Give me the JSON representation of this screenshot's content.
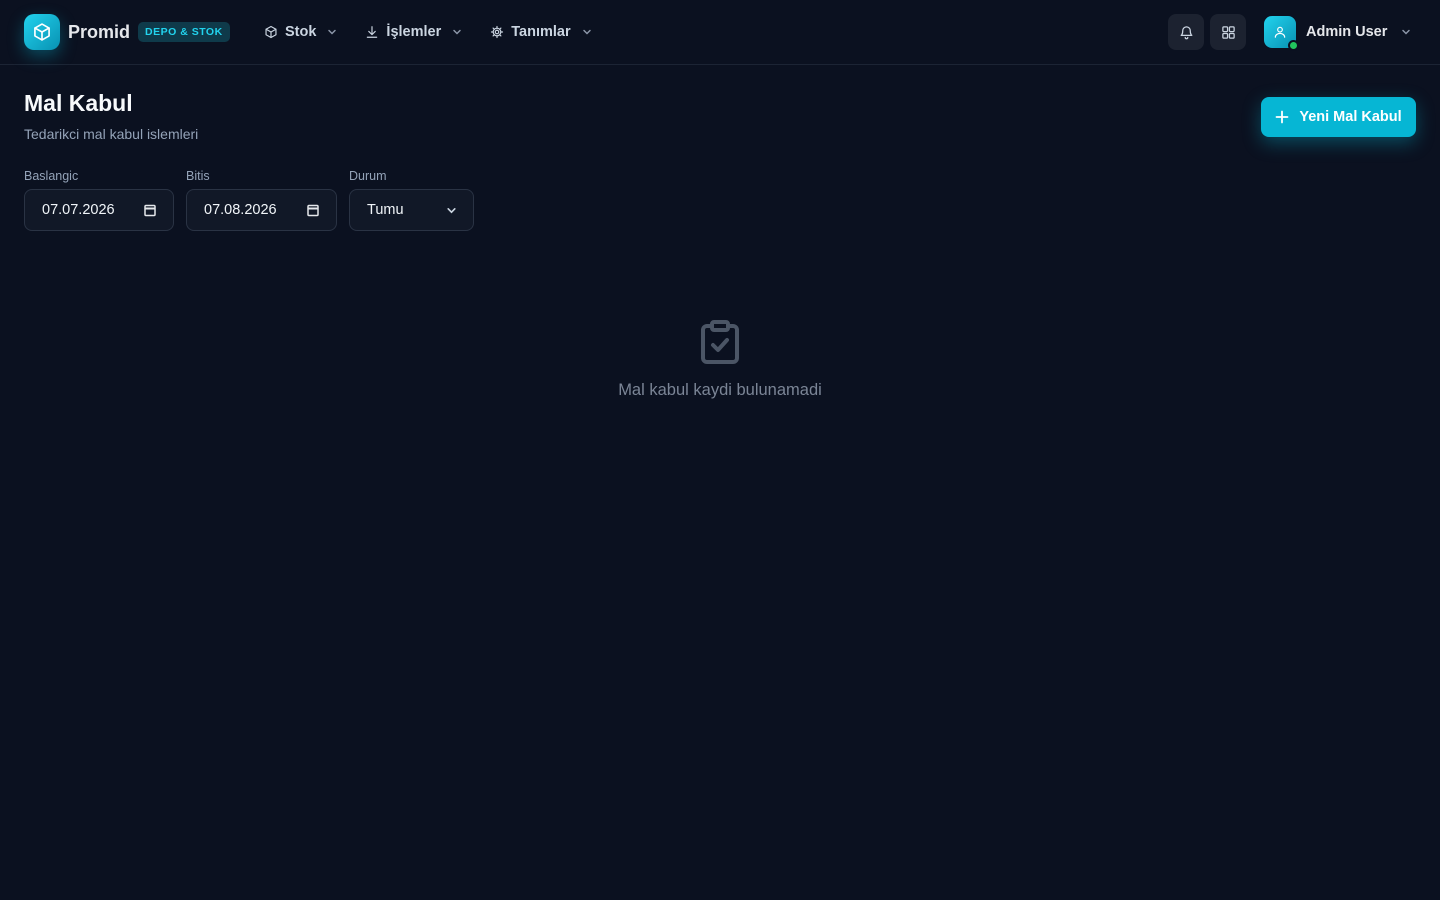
{
  "brand": {
    "name": "Promid",
    "badge": "DEPO & STOK"
  },
  "nav": [
    {
      "label": "Stok",
      "icon": "package-icon"
    },
    {
      "label": "İşlemler",
      "icon": "download-icon"
    },
    {
      "label": "Tanımlar",
      "icon": "gear-icon"
    }
  ],
  "header_actions": {
    "notifications_icon": "bell-icon",
    "apps_icon": "grid-icon"
  },
  "user": {
    "name": "Admin User",
    "status": "online"
  },
  "page": {
    "title": "Mal Kabul",
    "subtitle": "Tedarikci mal kabul islemleri",
    "new_button": "Yeni Mal Kabul"
  },
  "filters": {
    "start": {
      "label": "Baslangic",
      "value": "07.07.2026"
    },
    "end": {
      "label": "Bitis",
      "value": "07.08.2026"
    },
    "status": {
      "label": "Durum",
      "value": "Tumu"
    }
  },
  "empty_state": {
    "message": "Mal kabul kaydi bulunamadi",
    "icon": "clipboard-check-icon"
  },
  "colors": {
    "background": "#0b1120",
    "accent": "#06b6d4",
    "online": "#22c55e"
  }
}
